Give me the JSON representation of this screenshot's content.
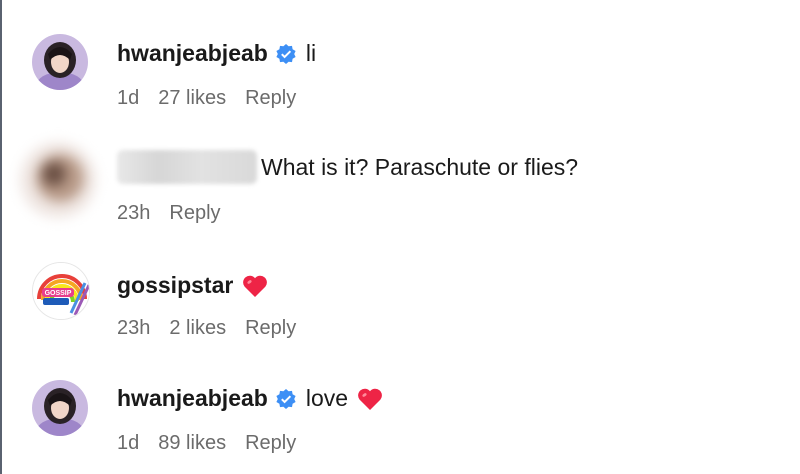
{
  "comments": [
    {
      "username": "hwanjeabjeab",
      "text": "li",
      "time": "1d",
      "likes": "27 likes",
      "reply": "Reply"
    },
    {
      "username": "",
      "text": "What is it? Paraschute or flies?",
      "time": "23h",
      "likes": "",
      "reply": "Reply"
    },
    {
      "username": "gossipstar",
      "text": "",
      "time": "23h",
      "likes": "2 likes",
      "reply": "Reply",
      "avatar_text": "GOSSIP"
    },
    {
      "username": "hwanjeabjeab",
      "text": "love",
      "time": "1d",
      "likes": "89 likes",
      "reply": "Reply"
    }
  ],
  "colors": {
    "verified": "#3d8ff5",
    "heart": "#ee2446",
    "meta": "#6b6b6b"
  }
}
